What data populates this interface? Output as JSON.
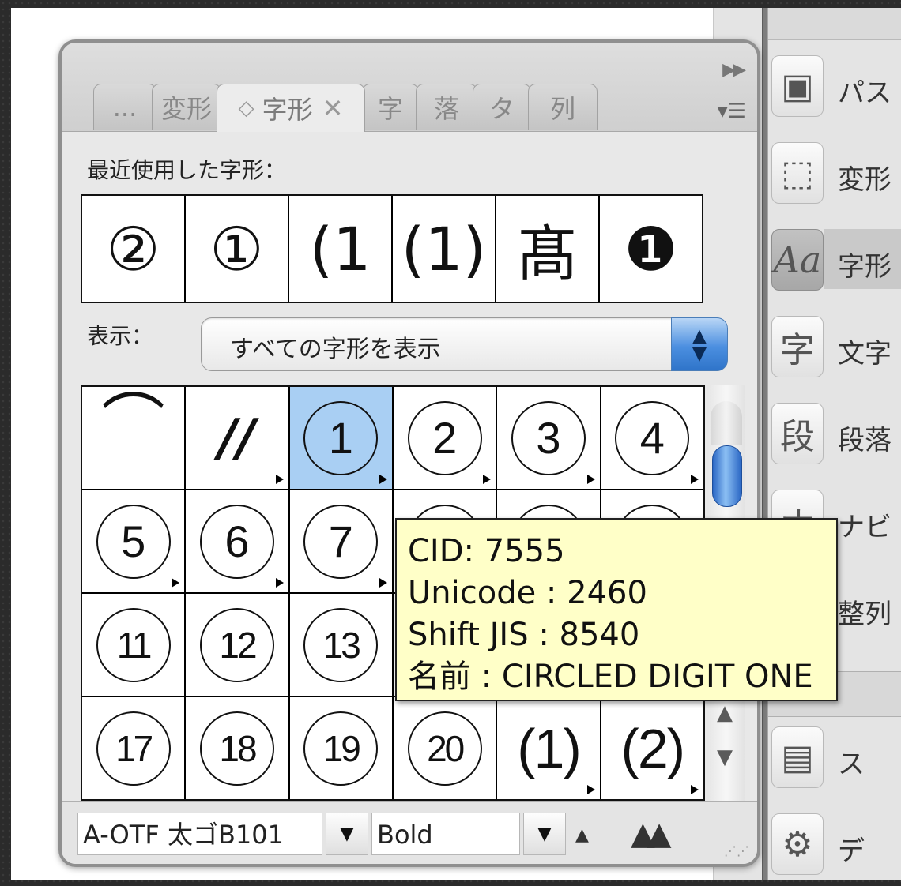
{
  "dock": {
    "items": [
      {
        "icon": "pathfinder-icon",
        "glyph": "▣",
        "label": "パス"
      },
      {
        "icon": "transform-icon",
        "glyph": "⬚",
        "label": "変形"
      },
      {
        "icon": "glyphs-icon",
        "glyph": "Aa",
        "label": "字形",
        "active": true
      },
      {
        "icon": "character-icon",
        "glyph": "字",
        "label": "文字"
      },
      {
        "icon": "paragraph-icon",
        "glyph": "段",
        "label": "段落"
      },
      {
        "icon": "navigator-icon",
        "glyph": "ナ",
        "label": "ナビ"
      },
      {
        "icon": "align-icon",
        "glyph": "整",
        "label": "整列"
      },
      {
        "icon": "swatch-library-icon",
        "glyph": "▤",
        "label": "ス"
      },
      {
        "icon": "data-merge-icon",
        "glyph": "⚙",
        "label": "デ"
      }
    ]
  },
  "panel": {
    "tabs": [
      {
        "label": "..."
      },
      {
        "label": "変形"
      },
      {
        "label": "字形",
        "active": true
      },
      {
        "label": "字"
      },
      {
        "label": "落"
      },
      {
        "label": "タ"
      },
      {
        "label": "列"
      }
    ],
    "recent_label": "最近使用した字形：",
    "recent_glyphs": [
      "②",
      "①",
      "(1",
      "(1)",
      "髙",
      "❶"
    ],
    "show_label": "表示：",
    "show_value": "すべての字形を表示",
    "glyphs": [
      {
        "text": "⌒",
        "kind": "plain"
      },
      {
        "text": "//",
        "kind": "plain",
        "tri": true
      },
      {
        "text": "1",
        "kind": "circle",
        "tri": true,
        "selected": true
      },
      {
        "text": "2",
        "kind": "circle",
        "tri": true
      },
      {
        "text": "3",
        "kind": "circle",
        "tri": true
      },
      {
        "text": "4",
        "kind": "circle",
        "tri": true
      },
      {
        "text": "5",
        "kind": "circle",
        "tri": true
      },
      {
        "text": "6",
        "kind": "circle",
        "tri": true
      },
      {
        "text": "7",
        "kind": "circle",
        "tri": true
      },
      {
        "text": "",
        "kind": "circle"
      },
      {
        "text": "",
        "kind": "circle"
      },
      {
        "text": "",
        "kind": "circle"
      },
      {
        "text": "11",
        "kind": "circle"
      },
      {
        "text": "12",
        "kind": "circle"
      },
      {
        "text": "13",
        "kind": "circle"
      },
      {
        "text": "",
        "kind": "blank"
      },
      {
        "text": "",
        "kind": "blank"
      },
      {
        "text": "",
        "kind": "blank"
      },
      {
        "text": "17",
        "kind": "circle"
      },
      {
        "text": "18",
        "kind": "circle"
      },
      {
        "text": "19",
        "kind": "circle"
      },
      {
        "text": "20",
        "kind": "circle"
      },
      {
        "text": "(1)",
        "kind": "paren",
        "tri": true
      },
      {
        "text": "(2)",
        "kind": "paren",
        "tri": true
      }
    ],
    "font_family": "A-OTF 太ゴB101",
    "font_style": "Bold"
  },
  "tooltip": {
    "cid": "CID: 7555",
    "unicode": "Unicode : 2460",
    "sjis": "Shift JIS : 8540",
    "name": "名前 : CIRCLED DIGIT ONE"
  }
}
